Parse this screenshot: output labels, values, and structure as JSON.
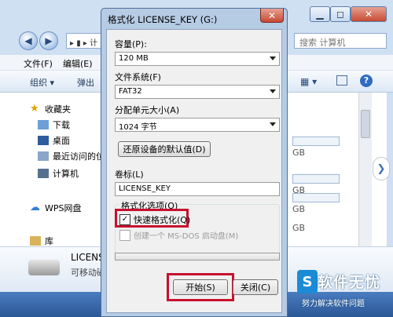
{
  "explorer": {
    "address_frag": "▸ ▮ ▸ 计",
    "search_placeholder": "搜索 计算机",
    "menu": [
      "文件(F)",
      "编辑(E)"
    ],
    "toolbar": {
      "organize": "组织 ▾",
      "eject": "弹出"
    },
    "nav": {
      "favorites": "收藏夹",
      "downloads": "下载",
      "desktop": "桌面",
      "recent": "最近访问的位",
      "computer": "计算机",
      "wps": "WPS网盘",
      "libraries": "库"
    },
    "drive_gb": [
      "GB",
      "GB",
      "GB",
      "GB"
    ],
    "details": {
      "name": "LICENS",
      "type": "可移动磁"
    }
  },
  "dialog": {
    "title": "格式化 LICENSE_KEY (G:)",
    "close_glyph": "✕",
    "capacity_label": "容量(P):",
    "capacity_value": "120 MB",
    "filesystem_label": "文件系统(F)",
    "filesystem_value": "FAT32",
    "alloc_label": "分配单元大小(A)",
    "alloc_value": "1024 字节",
    "restore_button": "还原设备的默认值(D)",
    "volume_label": "卷标(L)",
    "volume_value": "LICENSE_KEY",
    "options_label": "格式化选项(O)",
    "quick_format": "快速格式化(Q)",
    "msdos_disk": "创建一个 MS-DOS 启动盘(M)",
    "start_button": "开始(S)",
    "close_button": "关闭(C)"
  },
  "watermark": {
    "logo": "S",
    "title": "软件无忧",
    "subtitle": "努力解决软件问题"
  },
  "colors": {
    "highlight": "#c8102e",
    "title_blue": "#b6cbe4"
  }
}
